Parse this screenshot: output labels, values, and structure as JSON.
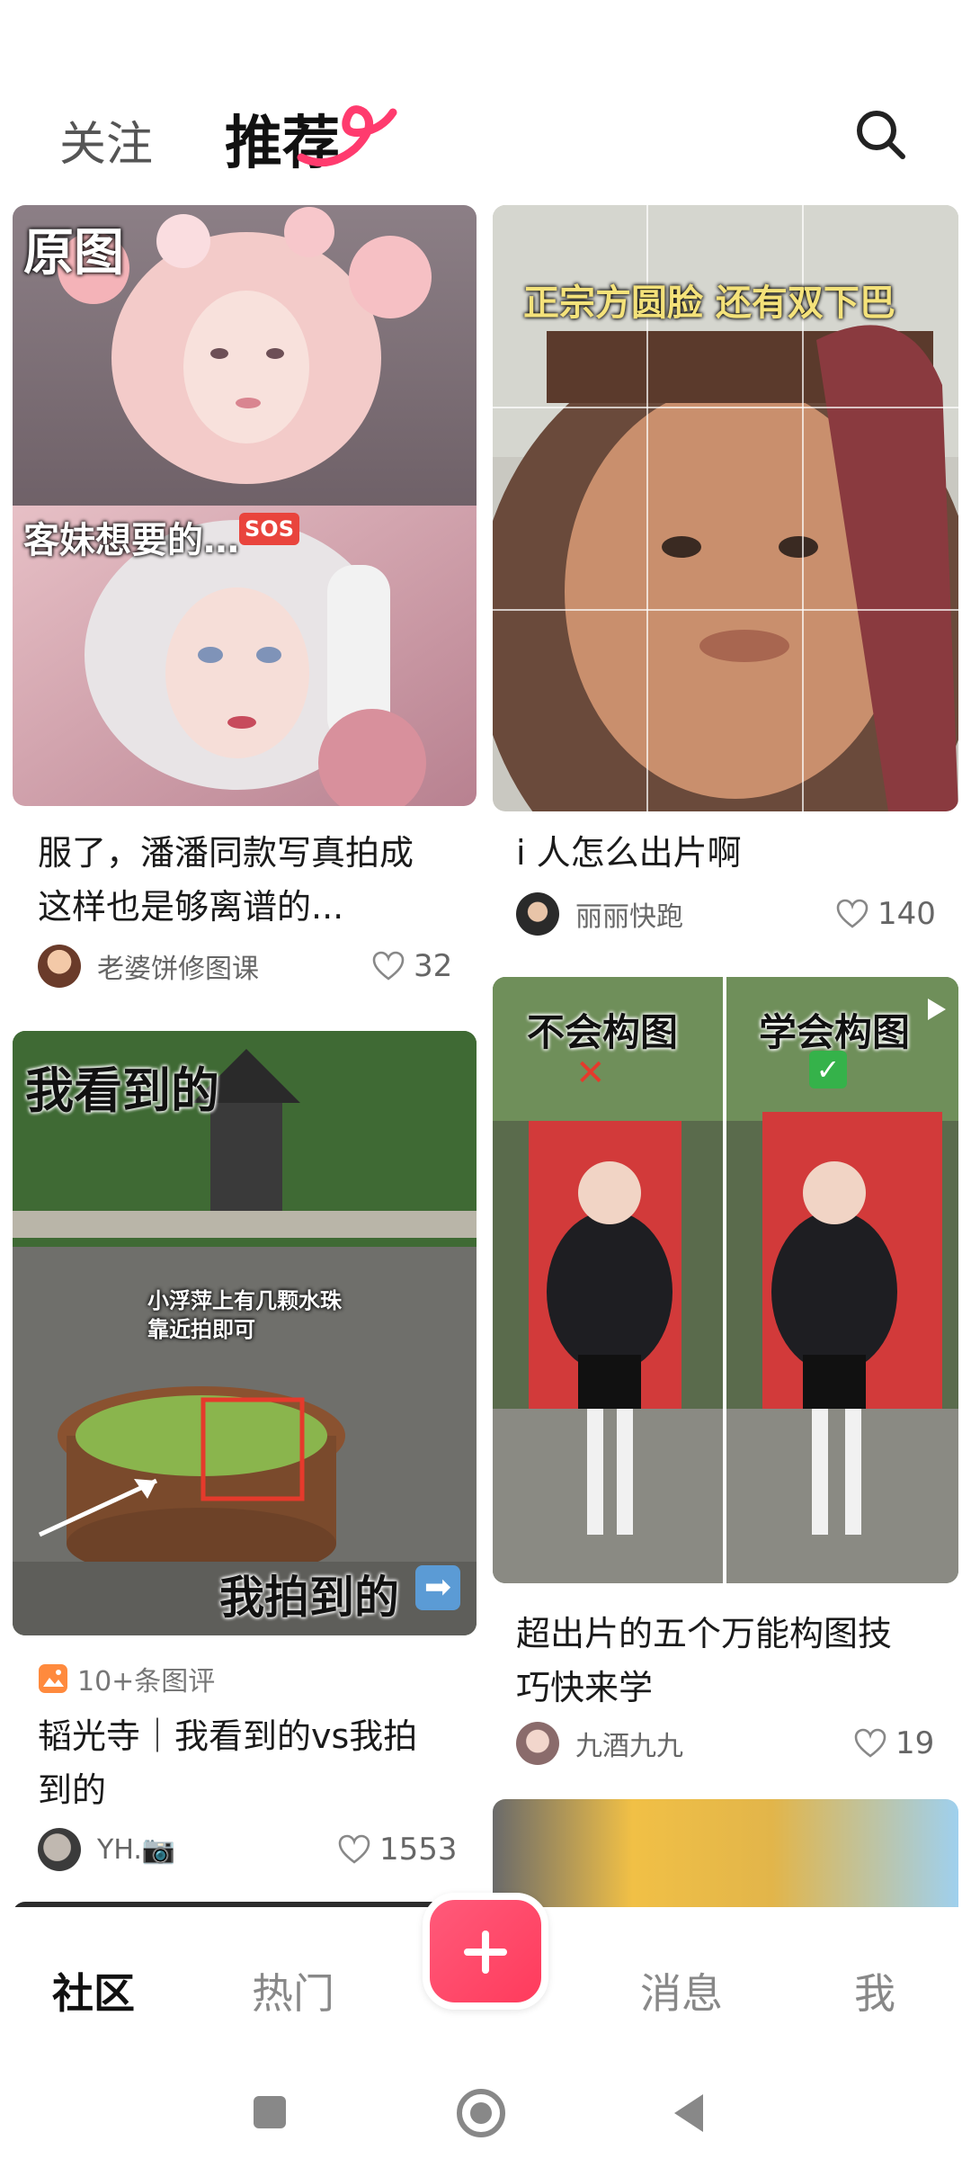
{
  "header": {
    "tab_follow": "关注",
    "tab_recommend": "推荐",
    "search_icon": "search-icon"
  },
  "feed": {
    "card1": {
      "overlay_top": "原图",
      "overlay_mid": "客妹想要的…",
      "overlay_badge": "SOS",
      "title_line1": "服了，潘潘同款写真拍成",
      "title_line2": "这样也是够离谱的...",
      "author": "老婆饼修图课",
      "likes": "32"
    },
    "card2": {
      "overlay_top": "正宗方圆脸 还有双下巴",
      "title_line1": "i 人怎么出片啊",
      "author": "丽丽快跑",
      "likes": "140"
    },
    "card3": {
      "overlay_top": "我看到的",
      "overlay_mid_line1": "小浮萍上有几颗水珠",
      "overlay_mid_line2": "靠近拍即可",
      "overlay_bottom": "我拍到的",
      "badge": "10+条图评",
      "title_line1": "韬光寺｜我看到的vs我拍",
      "title_line2": "到的",
      "author": "YH.📷",
      "likes": "1553"
    },
    "card4": {
      "overlay_left": "不会构图",
      "overlay_right": "学会构图",
      "title_line1": "超出片的五个万能构图技",
      "title_line2": "巧快来学",
      "author": "九酒九九",
      "likes": "19"
    }
  },
  "bottom_nav": {
    "community": "社区",
    "hot": "热门",
    "messages": "消息",
    "me": "我"
  },
  "colors": {
    "accent": "#ff3b5c",
    "text_primary": "#1a1a1a",
    "text_secondary": "#666666"
  }
}
